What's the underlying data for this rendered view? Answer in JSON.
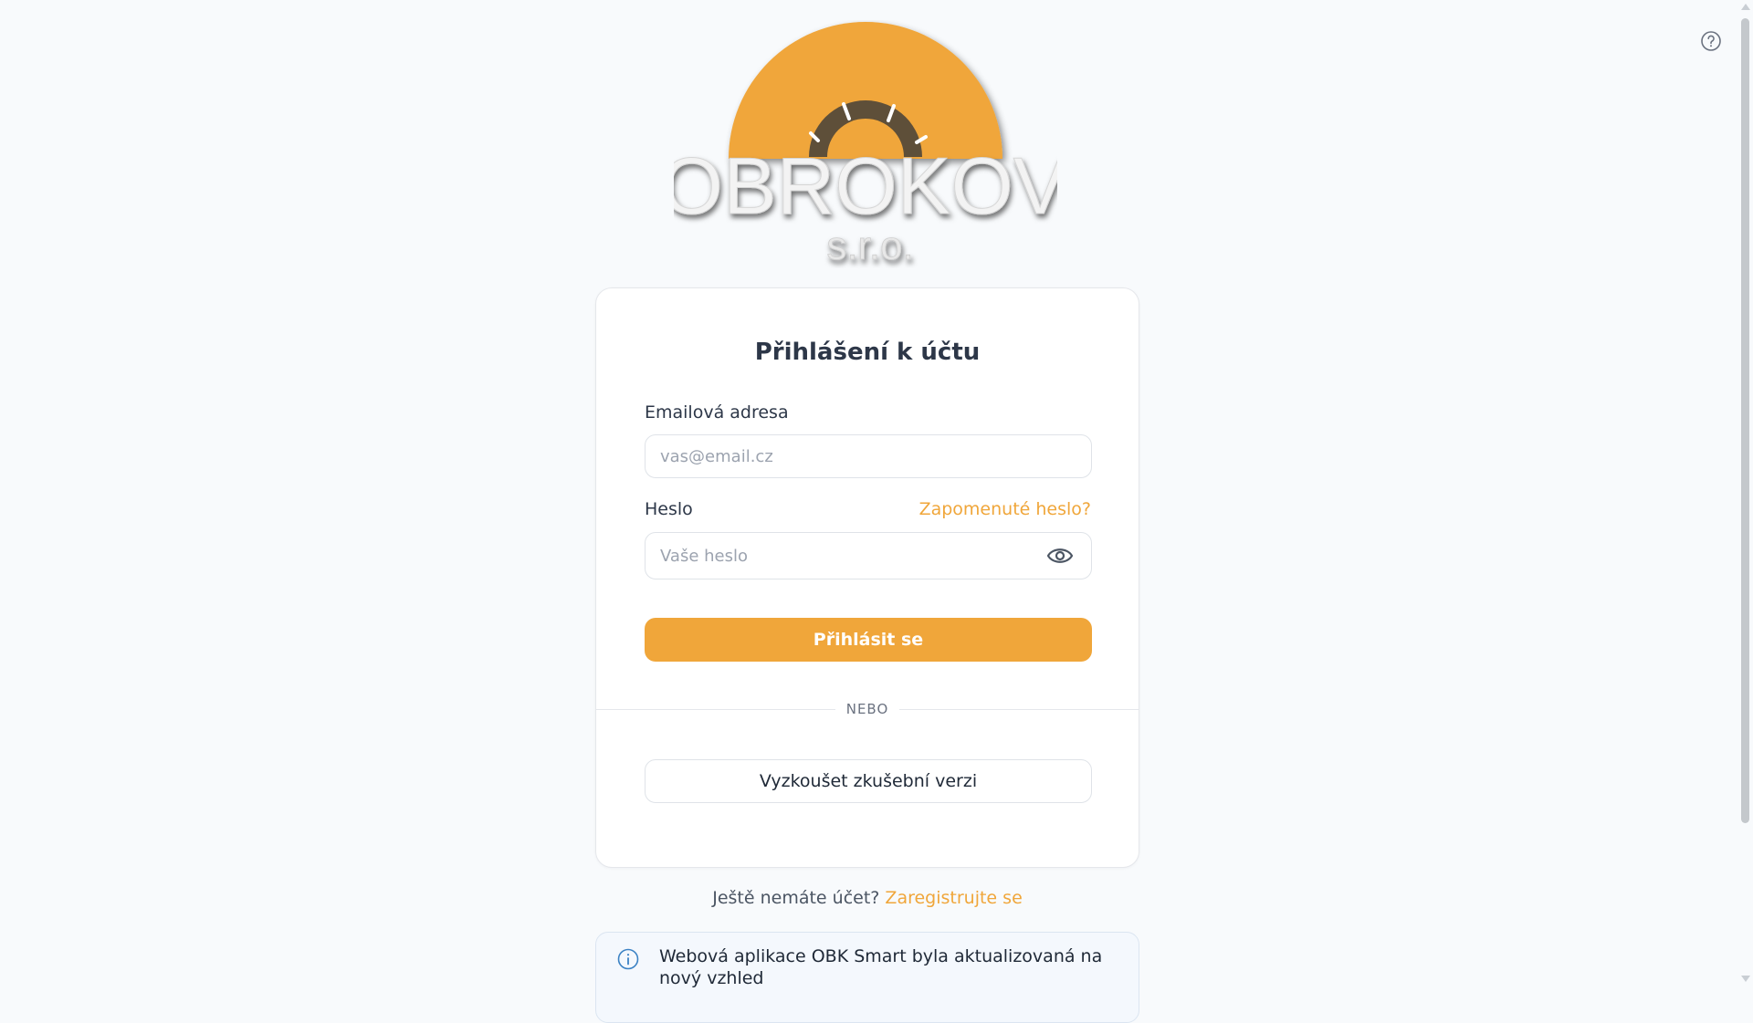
{
  "brand": {
    "name": "OBROKOV",
    "suffix": "s.r.o.",
    "accent_color": "#f0a63a"
  },
  "help": {
    "icon": "question-circle-icon"
  },
  "login": {
    "title": "Přihlášení k účtu",
    "email_label": "Emailová adresa",
    "email_placeholder": "vas@email.cz",
    "email_value": "",
    "password_label": "Heslo",
    "forgot_password": "Zapomenuté heslo?",
    "password_placeholder": "Vaše heslo",
    "password_value": "",
    "toggle_visibility_icon": "eye-icon",
    "submit_label": "Přihlásit se",
    "divider": "NEBO",
    "trial_label": "Vyzkoušet zkušební verzi"
  },
  "register": {
    "prompt": "Ještě nemáte účet?",
    "link": "Zaregistrujte se"
  },
  "notice": {
    "icon": "info-icon",
    "text": "Webová aplikace OBK Smart byla aktualizovaná na nový vzhled"
  }
}
